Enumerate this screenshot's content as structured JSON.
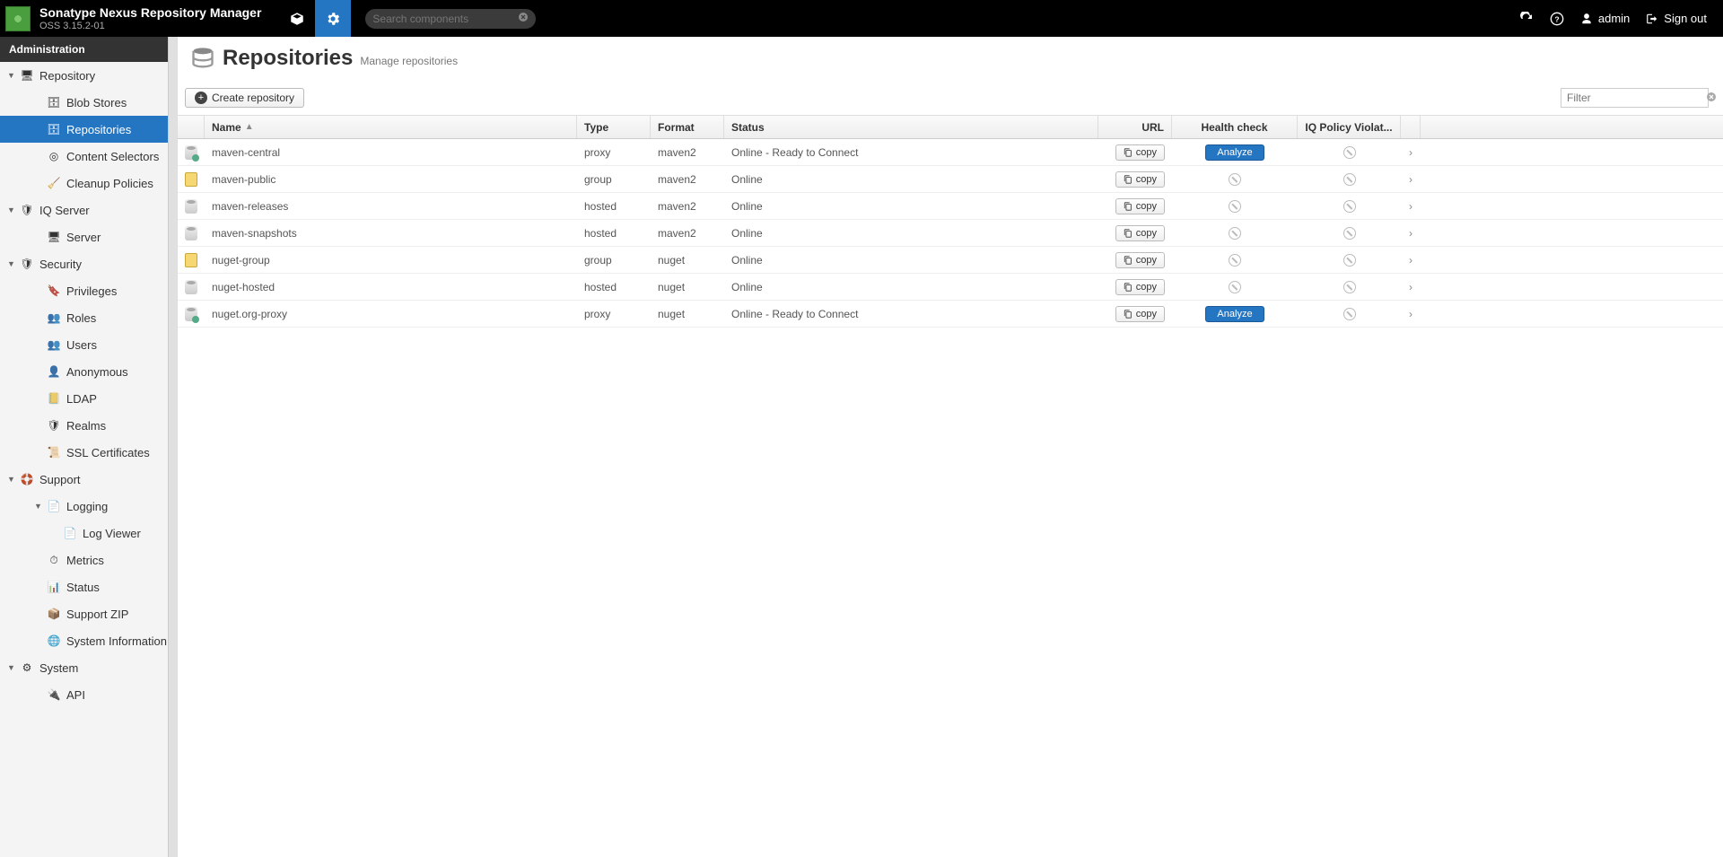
{
  "header": {
    "title": "Sonatype Nexus Repository Manager",
    "version": "OSS 3.15.2-01",
    "search_placeholder": "Search components",
    "user": "admin",
    "signout": "Sign out"
  },
  "sidebar": {
    "header": "Administration",
    "tree": [
      {
        "label": "Repository",
        "level": 1,
        "expandable": true,
        "expanded": true,
        "icon": "server"
      },
      {
        "label": "Blob Stores",
        "level": 2,
        "icon": "cylinder"
      },
      {
        "label": "Repositories",
        "level": 2,
        "icon": "cylinder",
        "selected": true
      },
      {
        "label": "Content Selectors",
        "level": 2,
        "icon": "target"
      },
      {
        "label": "Cleanup Policies",
        "level": 2,
        "icon": "broom"
      },
      {
        "label": "IQ Server",
        "level": 1,
        "expandable": true,
        "expanded": true,
        "icon": "shield"
      },
      {
        "label": "Server",
        "level": 2,
        "icon": "server"
      },
      {
        "label": "Security",
        "level": 1,
        "expandable": true,
        "expanded": true,
        "icon": "shield"
      },
      {
        "label": "Privileges",
        "level": 2,
        "icon": "badge"
      },
      {
        "label": "Roles",
        "level": 2,
        "icon": "users"
      },
      {
        "label": "Users",
        "level": 2,
        "icon": "users"
      },
      {
        "label": "Anonymous",
        "level": 2,
        "icon": "user"
      },
      {
        "label": "LDAP",
        "level": 2,
        "icon": "book"
      },
      {
        "label": "Realms",
        "level": 2,
        "icon": "shield"
      },
      {
        "label": "SSL Certificates",
        "level": 2,
        "icon": "cert"
      },
      {
        "label": "Support",
        "level": 1,
        "expandable": true,
        "expanded": true,
        "icon": "lifebuoy"
      },
      {
        "label": "Logging",
        "level": 2,
        "expandable": true,
        "expanded": true,
        "icon": "doc"
      },
      {
        "label": "Log Viewer",
        "level": 3,
        "icon": "doc"
      },
      {
        "label": "Metrics",
        "level": 2,
        "icon": "gauge"
      },
      {
        "label": "Status",
        "level": 2,
        "icon": "chart"
      },
      {
        "label": "Support ZIP",
        "level": 2,
        "icon": "zip"
      },
      {
        "label": "System Information",
        "level": 2,
        "icon": "globe"
      },
      {
        "label": "System",
        "level": 1,
        "expandable": true,
        "expanded": true,
        "icon": "gear"
      },
      {
        "label": "API",
        "level": 2,
        "icon": "api"
      }
    ]
  },
  "page": {
    "title": "Repositories",
    "subtitle": "Manage repositories",
    "create_btn": "Create repository",
    "filter_placeholder": "Filter",
    "columns": {
      "name": "Name",
      "type": "Type",
      "format": "Format",
      "status": "Status",
      "url": "URL",
      "health": "Health check",
      "iq": "IQ Policy Violat..."
    },
    "copy_label": "copy",
    "analyze_label": "Analyze",
    "rows": [
      {
        "icon": "proxy",
        "name": "maven-central",
        "type": "proxy",
        "format": "maven2",
        "status": "Online - Ready to Connect",
        "health": "analyze"
      },
      {
        "icon": "group",
        "name": "maven-public",
        "type": "group",
        "format": "maven2",
        "status": "Online",
        "health": "na"
      },
      {
        "icon": "hosted",
        "name": "maven-releases",
        "type": "hosted",
        "format": "maven2",
        "status": "Online",
        "health": "na"
      },
      {
        "icon": "hosted",
        "name": "maven-snapshots",
        "type": "hosted",
        "format": "maven2",
        "status": "Online",
        "health": "na"
      },
      {
        "icon": "group",
        "name": "nuget-group",
        "type": "group",
        "format": "nuget",
        "status": "Online",
        "health": "na"
      },
      {
        "icon": "hosted",
        "name": "nuget-hosted",
        "type": "hosted",
        "format": "nuget",
        "status": "Online",
        "health": "na"
      },
      {
        "icon": "proxy",
        "name": "nuget.org-proxy",
        "type": "proxy",
        "format": "nuget",
        "status": "Online - Ready to Connect",
        "health": "analyze"
      }
    ]
  }
}
